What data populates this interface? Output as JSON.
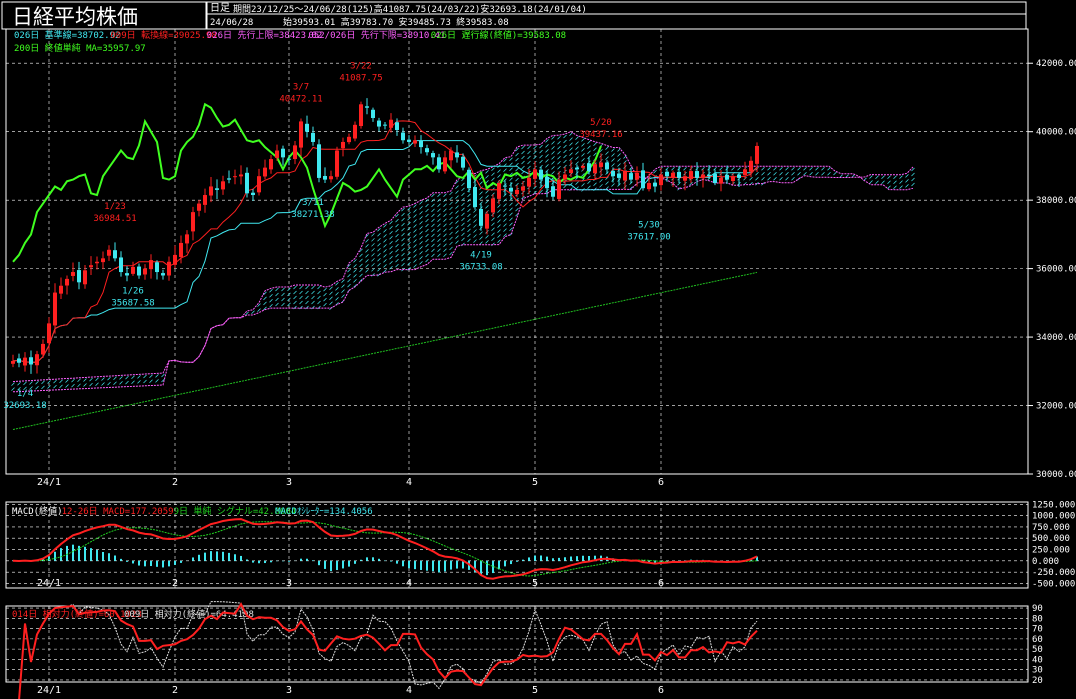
{
  "header": {
    "title": "日経平均株価",
    "period_type": "日足",
    "period_info": "期間23/12/25～24/06/28(125)高41087.75(24/03/22)安32693.18(24/01/04)",
    "date": "24/06/28",
    "ohlc": "始39593.01 高39783.70 安39485.73 終39583.08"
  },
  "colors": {
    "bg": "#000000",
    "up": "#ff2020",
    "down": "#40e8f0",
    "kijun": "#40e8f0",
    "tenkan": "#ff2020",
    "span_a": "#ff60ff",
    "span_b": "#ff60ff",
    "chikou": "#40ff20",
    "ma200": "#20c020",
    "macd": "#ff2020",
    "signal": "#20d020",
    "osc": "#40e8f0",
    "rsi14": "#ff2020",
    "rsi9": "#e0e0e0",
    "grid": "#ffffff"
  },
  "legend": {
    "row1": [
      {
        "text": "026日 基準線=38702.92",
        "color": "#40e8f0"
      },
      {
        "text": "009日 転換線=39025.98",
        "color": "#ff2020"
      },
      {
        "text": "026日 先行上限=38423.02",
        "color": "#ff60ff"
      },
      {
        "text": "052/026日 先行下限=38910.41",
        "color": "#ff60ff"
      },
      {
        "text": "026日 遅行線(終値)=39583.08",
        "color": "#40ff20"
      }
    ],
    "row2": [
      {
        "text": "200日 終値単純 MA=35957.97",
        "color": "#40ff20"
      }
    ]
  },
  "macd_legend": [
    {
      "text": "MACD(終値)",
      "color": "#ffffff"
    },
    {
      "text": "12-26日 MACD=177.2059",
      "color": "#ff2020"
    },
    {
      "text": "9日 単純 シグナル=42.8004",
      "color": "#20d020"
    },
    {
      "text": "MACDｵｼﾚｰﾀｰ=134.4056",
      "color": "#40e8f0"
    }
  ],
  "rsi_legend": [
    {
      "text": "014日 相対力(終値)=60.1023",
      "color": "#ff2020"
    },
    {
      "text": "009日 相対力(終値)=64.4198",
      "color": "#e0e0e0"
    }
  ],
  "chart_data": {
    "type": "candlestick",
    "price_axis": {
      "ylim": [
        30000,
        43000
      ],
      "ticks": [
        "42000.00",
        "40000.00",
        "38000.00",
        "36000.00",
        "34000.00",
        "32000.00",
        "30000.00"
      ]
    },
    "macd_axis": {
      "ylim": [
        -600,
        1300
      ],
      "ticks": [
        "1250.000",
        "1000.000",
        "750.000",
        "500.000",
        "250.000",
        "0.000",
        "-250.000",
        "-500.000"
      ]
    },
    "rsi_axis": {
      "ylim": [
        18,
        92
      ],
      "ticks": [
        "90",
        "80",
        "70",
        "60",
        "50",
        "40",
        "30",
        "20"
      ]
    },
    "x_labels": [
      {
        "label": "24/1",
        "i": 6
      },
      {
        "label": "2",
        "i": 27
      },
      {
        "label": "3",
        "i": 46
      },
      {
        "label": "4",
        "i": 66
      },
      {
        "label": "5",
        "i": 87
      },
      {
        "label": "6",
        "i": 108
      }
    ],
    "annotations": [
      {
        "date": "1/23",
        "value": "36984.51",
        "i": 17,
        "price": 36984.51,
        "pos": "above"
      },
      {
        "date": "1/26",
        "value": "35687.58",
        "i": 20,
        "price": 35687.58,
        "pos": "below"
      },
      {
        "date": "3/7",
        "value": "40472.11",
        "i": 48,
        "price": 40472.11,
        "pos": "above"
      },
      {
        "date": "3/22",
        "value": "41087.75",
        "i": 58,
        "price": 41087.75,
        "pos": "above"
      },
      {
        "date": "3/11",
        "value": "38271.38",
        "i": 50,
        "price": 38271.38,
        "pos": "below"
      },
      {
        "date": "4/19",
        "value": "36733.08",
        "i": 78,
        "price": 36733.08,
        "pos": "below"
      },
      {
        "date": "5/20",
        "value": "39437.16",
        "i": 98,
        "price": 39437.16,
        "pos": "above"
      },
      {
        "date": "5/30",
        "value": "37617.00",
        "i": 106,
        "price": 37617.0,
        "pos": "below"
      },
      {
        "date": "1/4",
        "value": "32693.18",
        "i": 2,
        "price": 32693.18,
        "pos": "below"
      }
    ],
    "closes": [
      33300,
      33250,
      33400,
      33200,
      33500,
      33800,
      34400,
      35300,
      35500,
      35700,
      35900,
      35600,
      35950,
      36100,
      36200,
      36300,
      36550,
      36300,
      35900,
      35800,
      36050,
      35800,
      36000,
      36250,
      35900,
      35800,
      36200,
      36400,
      36750,
      37000,
      37650,
      37900,
      38150,
      38400,
      38300,
      38550,
      38600,
      38700,
      38750,
      38200,
      38150,
      38700,
      38950,
      39200,
      39450,
      39250,
      39200,
      39600,
      40300,
      40000,
      39700,
      38650,
      38600,
      38700,
      39450,
      39700,
      39850,
      40200,
      40800,
      40700,
      40400,
      40150,
      40200,
      40350,
      40050,
      39750,
      39700,
      39750,
      39550,
      39400,
      39250,
      38900,
      39250,
      39450,
      39250,
      38950,
      38350,
      37800,
      37250,
      37600,
      38050,
      38500,
      38400,
      38250,
      38300,
      38400,
      38650,
      38900,
      38600,
      38350,
      38100,
      38600,
      38750,
      38900,
      38900,
      39000,
      38850,
      39050,
      39100,
      38900,
      38700,
      38650,
      38850,
      38600,
      38800,
      38350,
      38500,
      38400,
      38750,
      38700,
      38800,
      38650,
      38700,
      38850,
      38650,
      38750,
      38700,
      38500,
      38650,
      38600,
      38700,
      38650,
      38900,
      39150,
      39583
    ]
  }
}
